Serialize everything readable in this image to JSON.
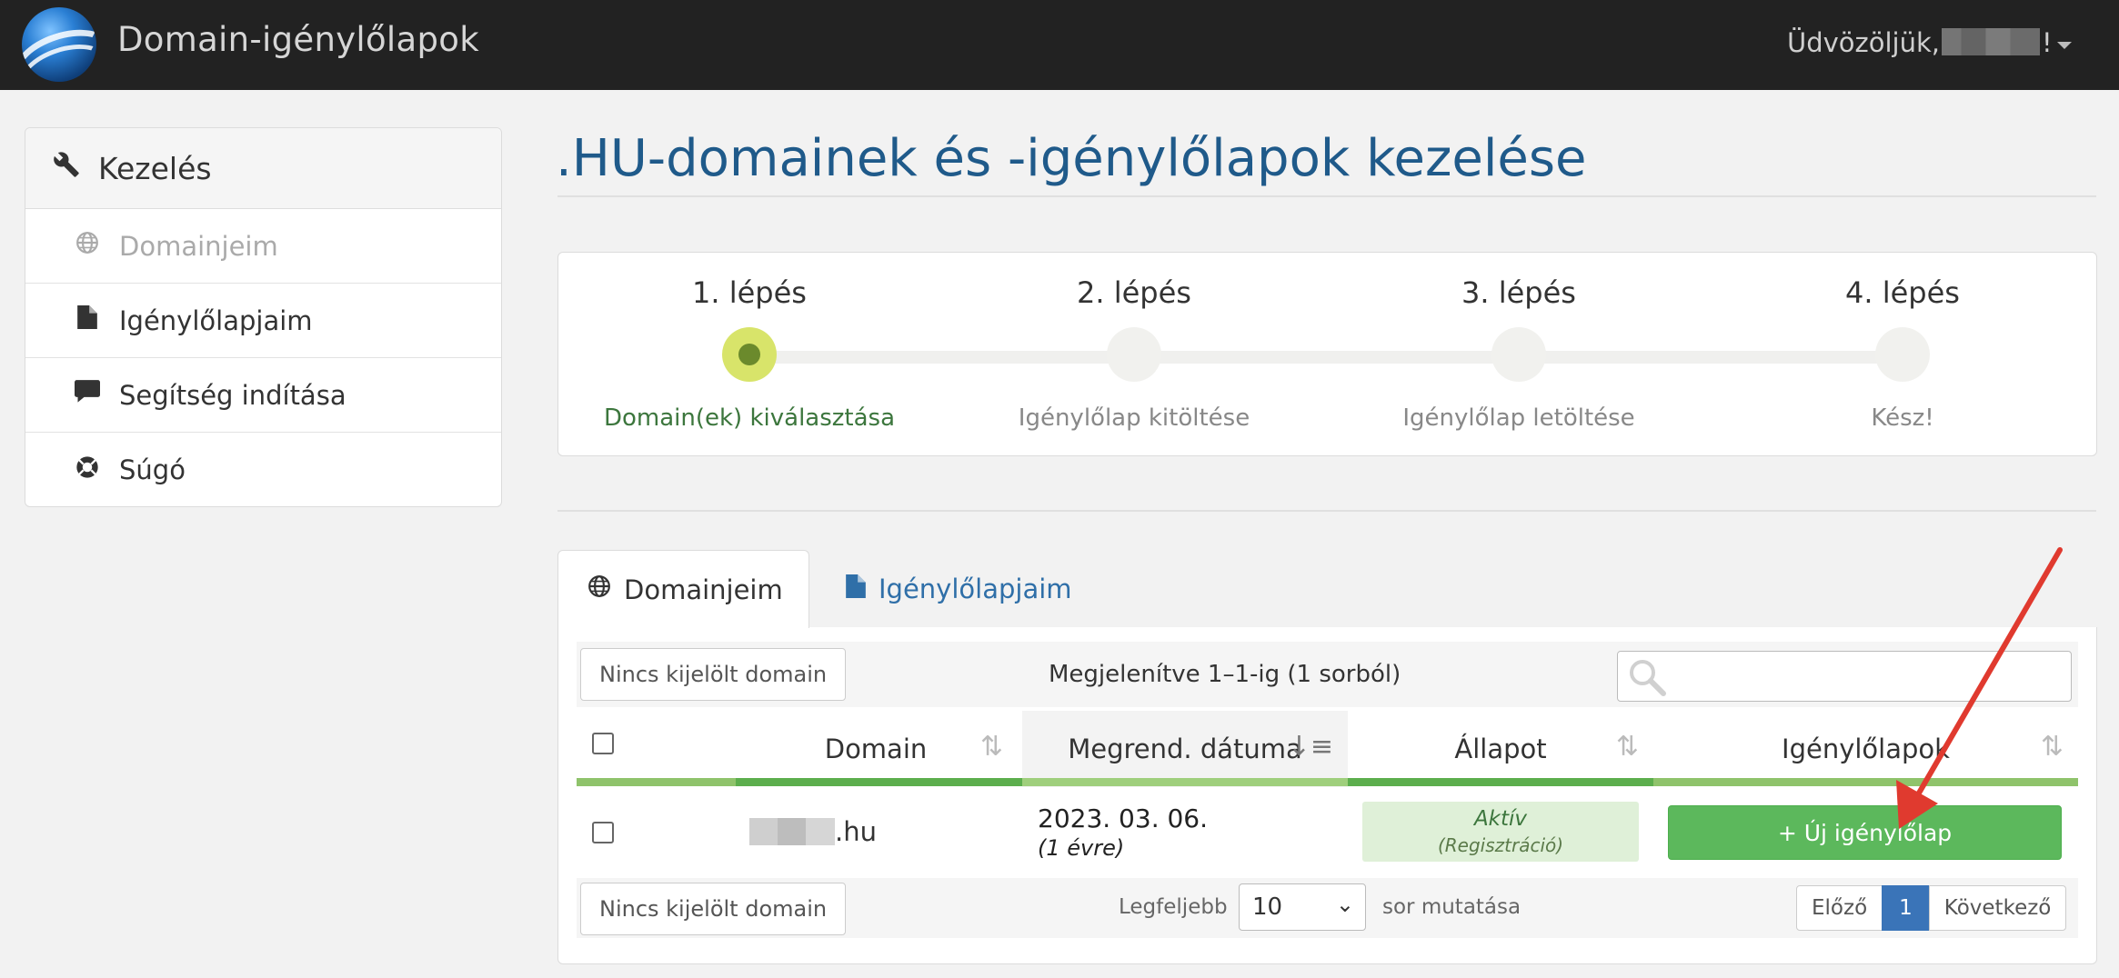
{
  "header": {
    "brand": "Domain-igénylőlapok",
    "welcome_prefix": "Üdvözöljük,",
    "welcome_suffix": "!",
    "logo_icon": "globe-logo-icon",
    "dropdown_icon": "caret-down-icon"
  },
  "sidebar": {
    "title": "Kezelés",
    "title_icon": "wrench-icon",
    "items": [
      {
        "label": "Domainjeim",
        "icon": "globe-icon",
        "disabled": true
      },
      {
        "label": "Igénylőlapjaim",
        "icon": "file-icon",
        "disabled": false
      },
      {
        "label": "Segítség indítása",
        "icon": "comment-icon",
        "disabled": false
      },
      {
        "label": "Súgó",
        "icon": "lifebuoy-icon",
        "disabled": false
      }
    ]
  },
  "main": {
    "title": ".HU-domainek és -igénylőlapok kezelése",
    "steps": [
      {
        "title": "1. lépés",
        "desc": "Domain(ek) kiválasztása",
        "active": true
      },
      {
        "title": "2. lépés",
        "desc": "Igénylőlap kitöltése",
        "active": false
      },
      {
        "title": "3. lépés",
        "desc": "Igénylőlap letöltése",
        "active": false
      },
      {
        "title": "4. lépés",
        "desc": "Kész!",
        "active": false
      }
    ],
    "tabs": [
      {
        "label": "Domainjeim",
        "icon": "globe-icon",
        "active": true
      },
      {
        "label": "Igénylőlapjaim",
        "icon": "file-icon",
        "active": false
      }
    ],
    "table": {
      "no_selection_label": "Nincs kijelölt domain",
      "info": "Megjelenítve 1–1-ig (1 sorból)",
      "search_placeholder": "",
      "columns": [
        "Domain",
        "Megrend. dátuma",
        "Állapot",
        "Igénylőlapok"
      ],
      "rows": [
        {
          "domain_suffix": ".hu",
          "date": "2023. 03. 06.",
          "date_sub": "(1 évre)",
          "status": "Aktív",
          "status_sub": "(Regisztráció)",
          "action_label": "+ Új igénylőlap"
        }
      ],
      "length_prefix": "Legfeljebb",
      "length_value": "10",
      "length_suffix": "sor mutatása",
      "pager": {
        "prev": "Előző",
        "current": "1",
        "next": "Következő"
      }
    }
  },
  "colors": {
    "accent_blue": "#1f5a8a",
    "success_green": "#5cb85c",
    "step_active": "#d8e46a",
    "annotation_arrow": "#e03a2f"
  }
}
